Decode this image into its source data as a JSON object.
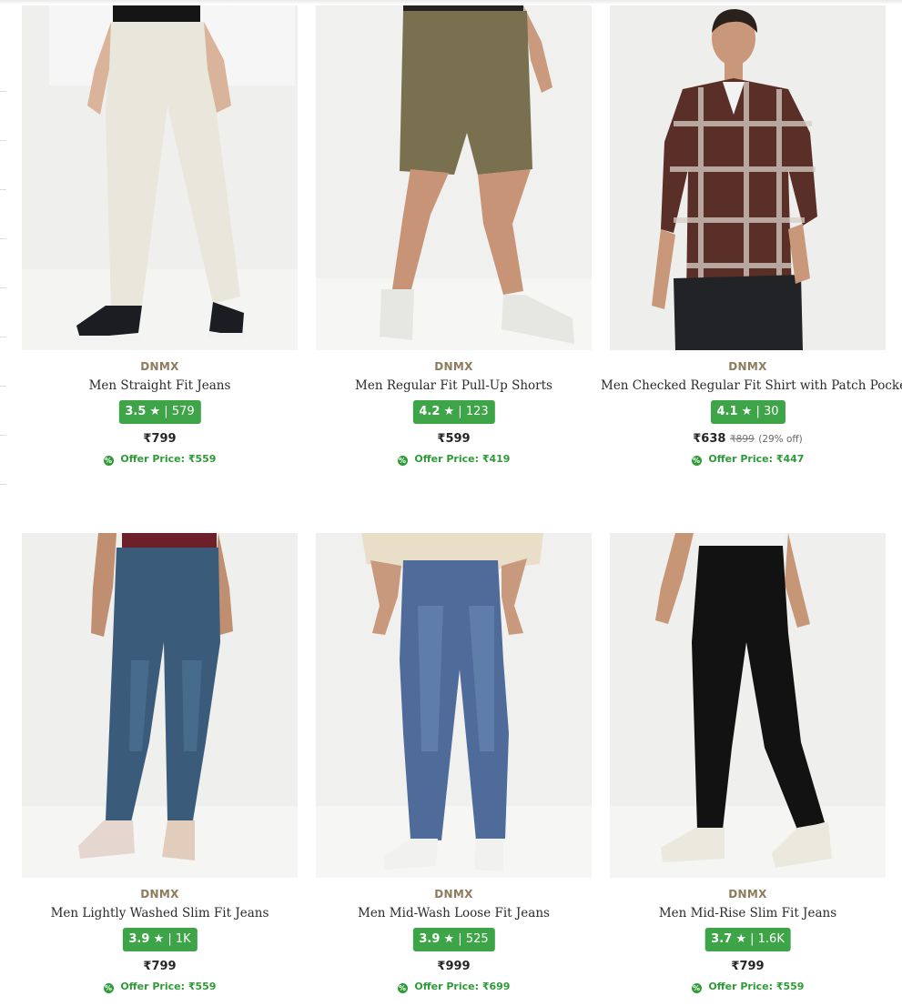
{
  "products": [
    {
      "brand": "DNMX",
      "title": "Men Straight Fit Jeans",
      "rating_value": "3.5",
      "rating_count": "579",
      "price": "₹799",
      "mrp": "",
      "discount": "",
      "offer_label": "Offer Price:",
      "offer_price": "₹559",
      "image": "off-white straight fit jeans with black sneakers"
    },
    {
      "brand": "DNMX",
      "title": "Men Regular Fit Pull-Up Shorts",
      "rating_value": "4.2",
      "rating_count": "123",
      "price": "₹599",
      "mrp": "",
      "discount": "",
      "offer_label": "Offer Price:",
      "offer_price": "₹419",
      "image": "olive pull-up shorts with white sneakers"
    },
    {
      "brand": "DNMX",
      "title": "Men Checked Regular Fit Shirt with Patch Pocket",
      "rating_value": "4.1",
      "rating_count": "30",
      "price": "₹638",
      "mrp": "₹899",
      "discount": "(29% off)",
      "offer_label": "Offer Price:",
      "offer_price": "₹447",
      "image": "brown checked shirt with black jeans"
    },
    {
      "brand": "DNMX",
      "title": "Men Lightly Washed Slim Fit Jeans",
      "rating_value": "3.9",
      "rating_count": "1K",
      "price": "₹799",
      "mrp": "",
      "discount": "",
      "offer_label": "Offer Price:",
      "offer_price": "₹559",
      "image": "blue lightly washed slim jeans with sneakers"
    },
    {
      "brand": "DNMX",
      "title": "Men Mid-Wash Loose Fit Jeans",
      "rating_value": "3.9",
      "rating_count": "525",
      "price": "₹999",
      "mrp": "",
      "discount": "",
      "offer_label": "Offer Price:",
      "offer_price": "₹699",
      "image": "mid-wash blue loose fit jeans with white sneakers"
    },
    {
      "brand": "DNMX",
      "title": "Men Mid-Rise Slim Fit Jeans",
      "rating_value": "3.7",
      "rating_count": "1.6K",
      "price": "₹799",
      "mrp": "",
      "discount": "",
      "offer_label": "Offer Price:",
      "offer_price": "₹559",
      "image": "black mid-rise slim jeans with white sneakers"
    }
  ],
  "rating_star": "★",
  "rating_separator": "|",
  "colors": {
    "rating_badge": "#3da547",
    "brand_text": "#8d7b5c",
    "offer_text": "#2e9a38",
    "image_background": "#ececea"
  }
}
